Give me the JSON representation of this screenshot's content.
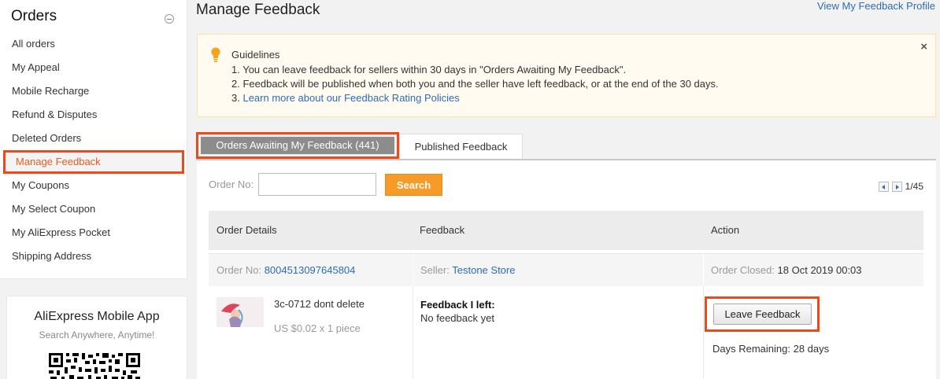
{
  "sidebar": {
    "title": "Orders",
    "items": [
      {
        "label": "All orders"
      },
      {
        "label": "My Appeal"
      },
      {
        "label": "Mobile Recharge"
      },
      {
        "label": "Refund & Disputes"
      },
      {
        "label": "Deleted Orders"
      },
      {
        "label": "Manage Feedback",
        "active": true
      },
      {
        "label": "My Coupons"
      },
      {
        "label": "My Select Coupon"
      },
      {
        "label": "My AliExpress Pocket"
      },
      {
        "label": "Shipping Address"
      }
    ]
  },
  "app_promo": {
    "title": "AliExpress Mobile App",
    "subtitle": "Search Anywhere, Anytime!"
  },
  "header": {
    "title": "Manage Feedback",
    "profile_link": "View My Feedback Profile"
  },
  "guidelines": {
    "title": "Guidelines",
    "line1": "1. You can leave feedback for sellers within 30 days in \"Orders Awaiting My Feedback\".",
    "line2": "2. Feedback will be published when both you and the seller have left feedback, or at the end of the 30 days.",
    "line3_prefix": "3. ",
    "line3_link": "Learn more about our Feedback Rating Policies",
    "close_glyph": "×"
  },
  "tabs": {
    "active": "Orders Awaiting My Feedback (441)",
    "inactive": "Published Feedback"
  },
  "search": {
    "label": "Order No:",
    "value": "",
    "button": "Search"
  },
  "pager": {
    "text": "1/45"
  },
  "table": {
    "headers": {
      "details": "Order Details",
      "feedback": "Feedback",
      "action": "Action"
    },
    "order": {
      "no_label": "Order No:",
      "no_value": "8004513097645804",
      "seller_label": "Seller:",
      "seller_value": "Testone Store",
      "closed_label": "Order Closed:",
      "closed_value": "18 Oct 2019 00:03"
    },
    "item": {
      "name": "3c-0712 dont delete",
      "price": "US $0.02 x 1 piece",
      "feedback_title": "Feedback I left:",
      "feedback_status": "No feedback yet",
      "action_button": "Leave Feedback",
      "days_remaining": "Days Remaining: 28 days"
    }
  },
  "colors": {
    "highlight": "#f0481b",
    "link": "#2d6bb9",
    "search_button": "#f69b27",
    "active_tab": "#8c8c8c"
  }
}
